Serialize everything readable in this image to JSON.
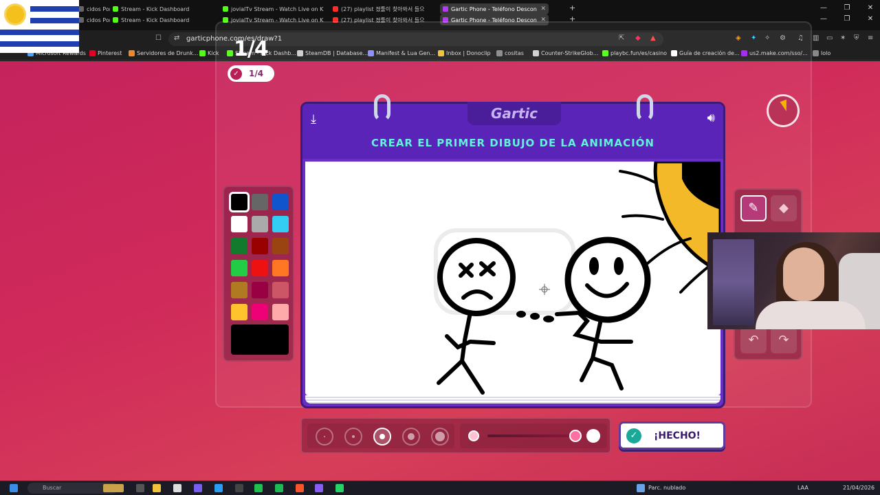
{
  "browser": {
    "tabs_row1": [
      {
        "label": "cidos Por S",
        "icon": "blank",
        "active": false
      },
      {
        "label": "Stream - Kick Dashboard",
        "icon": "kick",
        "active": false
      },
      {
        "label": "jovialTv Stream - Watch Live on K",
        "icon": "kick",
        "active": false
      },
      {
        "label": "(27) playlist 졌툴이 찾아와서 들으",
        "icon": "yt",
        "active": false
      },
      {
        "label": "Gartic Phone - Teléfono Descon",
        "icon": "gartic",
        "active": true
      }
    ],
    "tabs_row2": [
      {
        "label": "cidos Por S",
        "icon": "blank",
        "active": false
      },
      {
        "label": "Stream - Kick Dashboard",
        "icon": "kick",
        "active": false
      },
      {
        "label": "jovialTv Stream - Watch Live on K",
        "icon": "kick",
        "active": false
      },
      {
        "label": "(27) playlist 졌툴이 찾아와서 들으",
        "icon": "yt",
        "active": false
      },
      {
        "label": "Gartic Phone - Teléfono Descon",
        "icon": "gartic",
        "active": true
      }
    ],
    "new_tab": "+",
    "url": "garticphone.com/es/draw?1",
    "bookmarks": [
      {
        "label": "Microsoft Rewards",
        "color": "#4aa3ff"
      },
      {
        "label": "Pinterest",
        "color": "#e60023"
      },
      {
        "label": "Servidores de Drunk...",
        "color": "#f08a24"
      },
      {
        "label": "Kick",
        "color": "#53fc18"
      },
      {
        "label": "Stream - Kick Dashb...",
        "color": "#53fc18"
      },
      {
        "label": "SteamDB | Database...",
        "color": "#cccccc"
      },
      {
        "label": "Manifest & Lua Gen...",
        "color": "#8a8aff"
      },
      {
        "label": "Inbox | Donoclip",
        "color": "#f0c030"
      },
      {
        "label": "cositas",
        "color": "#888888"
      },
      {
        "label": "Counter-StrikeGlob...",
        "color": "#cfcfcf"
      },
      {
        "label": "playbc.fun/es/casino",
        "color": "#53fc18"
      },
      {
        "label": "Guía de creación de...",
        "color": "#ffffff"
      },
      {
        "label": "us2.make.com/sso/...",
        "color": "#a020f0"
      },
      {
        "label": "lolo",
        "color": "#888888"
      }
    ]
  },
  "game": {
    "round": "1/4",
    "round_badge": "1/4",
    "logo": "Gartic",
    "title": "CREAR EL PRIMER DIBUJO DE LA ANIMACIÓN",
    "done_label": "¡HECHO!",
    "colors": [
      "#000000",
      "#666666",
      "#1155cc",
      "#ffffff",
      "#aaaaaa",
      "#33ccf2",
      "#117a2c",
      "#990000",
      "#994411",
      "#22cc44",
      "#ee1111",
      "#ff7722",
      "#b07a22",
      "#990044",
      "#cc5566",
      "#ffc32e",
      "#ee0077",
      "#ffaaaa"
    ],
    "selected_color": "#000000",
    "brush_sizes": [
      2,
      4,
      8,
      10,
      14
    ],
    "selected_brush_index": 2,
    "opacity": 1.0
  },
  "taskbar": {
    "search_placeholder": "Buscar",
    "weather": "Parc. nublado",
    "lang": "LAA",
    "date": "21/04/2026"
  }
}
